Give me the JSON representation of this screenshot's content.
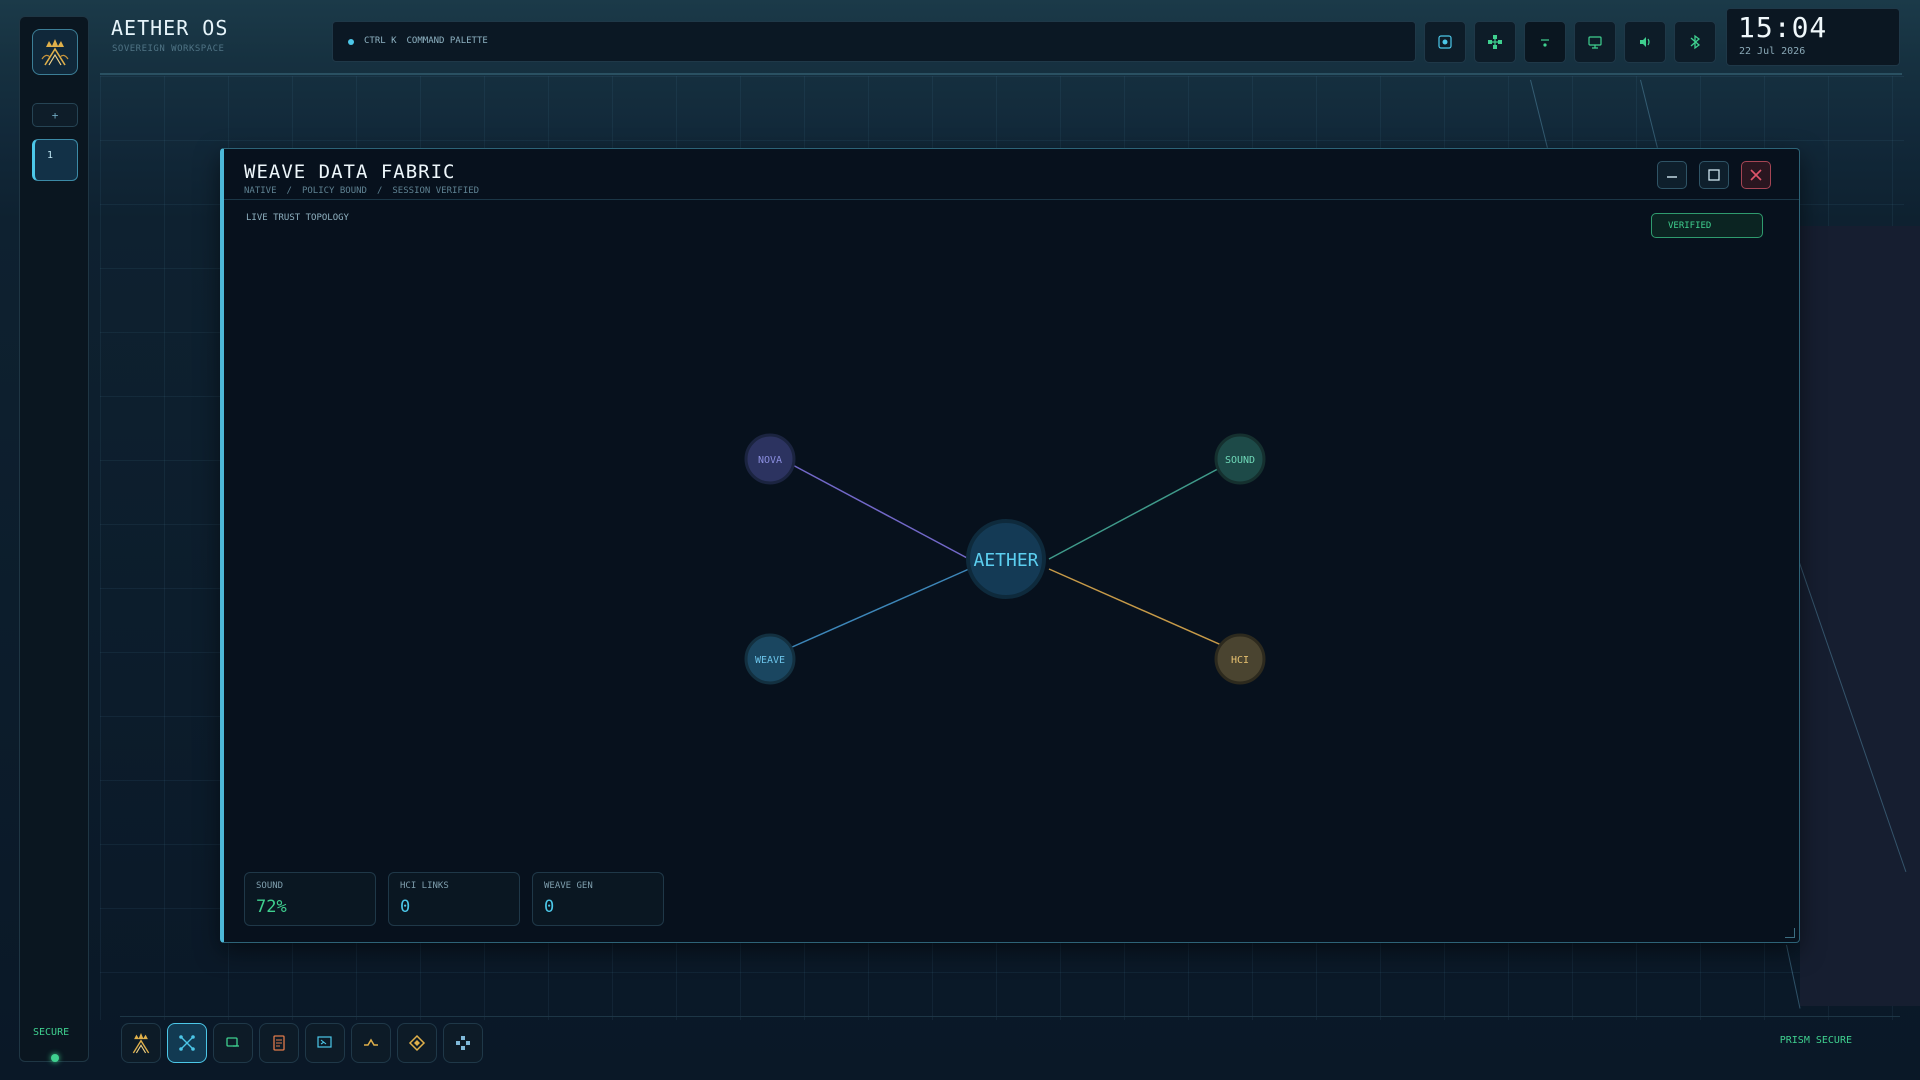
{
  "brand": {
    "title": "AETHER OS",
    "subtitle": "SOVEREIGN WORKSPACE"
  },
  "command_palette": {
    "shortcut": "CTRL K",
    "label": "COMMAND PALETTE"
  },
  "tray": [
    "screenshot-icon",
    "network-icon",
    "wifi-icon",
    "display-icon",
    "volume-icon",
    "bluetooth-icon"
  ],
  "clock": {
    "time": "15:04",
    "date": "22 Jul 2026"
  },
  "left_dock": {
    "add_label": "+",
    "workspace_label": "1",
    "status": "SECURE"
  },
  "window": {
    "title": "WEAVE DATA FABRIC",
    "breadcrumbs": [
      "NATIVE",
      "/",
      "POLICY BOUND",
      "/",
      "SESSION VERIFIED"
    ],
    "section_label": "LIVE TRUST TOPOLOGY",
    "badge": "VERIFIED",
    "topology": {
      "center": "AETHER",
      "nodes": [
        "NOVA",
        "SOUND",
        "WEAVE",
        "HCI"
      ]
    },
    "stats": [
      {
        "label": "SOUND",
        "value": "72%"
      },
      {
        "label": "HCI LINKS",
        "value": "0"
      },
      {
        "label": "WEAVE GEN",
        "value": "0"
      }
    ]
  },
  "taskbar": {
    "apps": [
      "aether-logo-icon",
      "weave-icon",
      "terminal-icon",
      "document-icon",
      "monitor-icon",
      "pulse-icon",
      "diamond-icon",
      "network-icon"
    ],
    "status": "PRISM SECURE"
  },
  "colors": {
    "accent": "#4cc7e8",
    "secure": "#3fd08f",
    "danger": "#e0556a",
    "warm": "#e0b04a"
  }
}
